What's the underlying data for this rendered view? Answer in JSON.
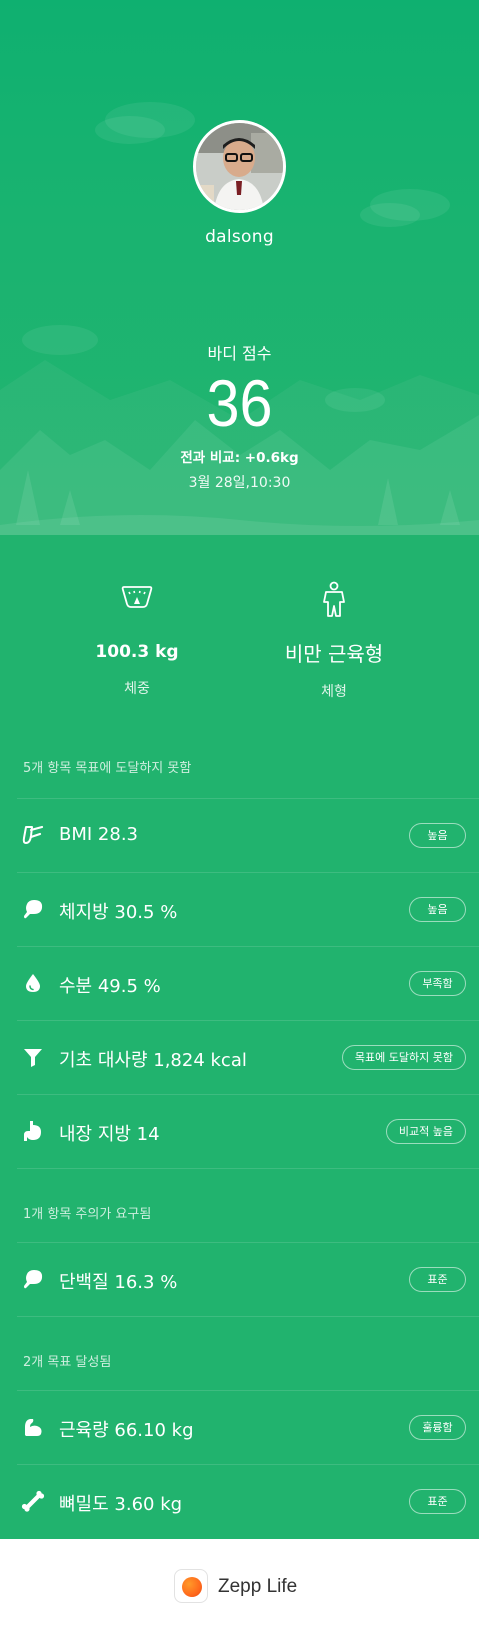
{
  "profile": {
    "username": "dalsong",
    "avatar_alt": "user-photo"
  },
  "score": {
    "label": "바디 점수",
    "value": "36",
    "compare": "전과 비교: +0.6kg",
    "date": "3월 28일,10:30"
  },
  "stats": {
    "weight": {
      "value": "100.3 kg",
      "label": "체중",
      "icon": "scale-icon"
    },
    "body_type": {
      "value": "비만 근육형",
      "label": "체형",
      "icon": "body-figure-icon"
    }
  },
  "sections": [
    {
      "header": "5개 항목 목표에 도달하지 못함",
      "items": [
        {
          "icon": "bmi-icon",
          "text": "BMI 28.3",
          "badge": "높음"
        },
        {
          "icon": "body-fat-icon",
          "text": "체지방 30.5 %",
          "badge": "높음"
        },
        {
          "icon": "water-drop-icon",
          "text": "수분 49.5 %",
          "badge": "부족함"
        },
        {
          "icon": "funnel-icon",
          "text": "기초 대사량 1,824 kcal",
          "badge": "목표에 도달하지 못함"
        },
        {
          "icon": "stomach-icon",
          "text": "내장 지방 14",
          "badge": "비교적 높음"
        }
      ]
    },
    {
      "header": "1개 항목 주의가 요구됨",
      "items": [
        {
          "icon": "protein-icon",
          "text": "단백질 16.3 %",
          "badge": "표준"
        }
      ]
    },
    {
      "header": "2개 목표 달성됨",
      "items": [
        {
          "icon": "muscle-icon",
          "text": "근육량 66.10 kg",
          "badge": "훌륭함"
        },
        {
          "icon": "bone-icon",
          "text": "뼈밀도 3.60 kg",
          "badge": "표준"
        }
      ]
    }
  ],
  "footer": {
    "app_name": "Zepp Life"
  },
  "colors": {
    "background": "#21b36e",
    "hero_top": "#0fb070",
    "footer": "#ffffff"
  }
}
